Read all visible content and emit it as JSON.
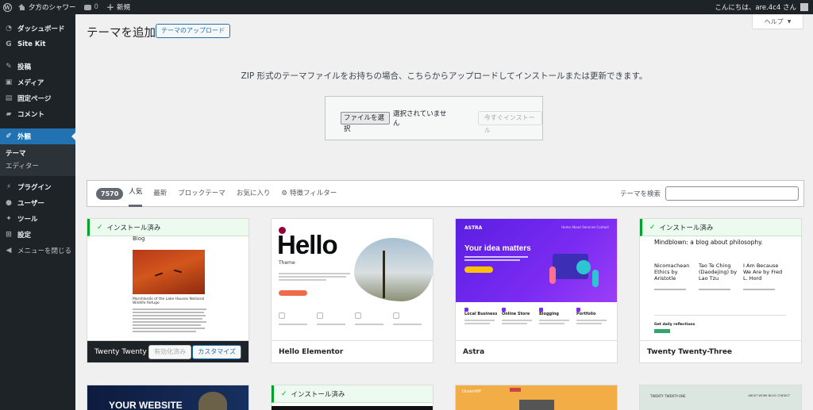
{
  "admin_bar": {
    "site_name": "夕方のシャワー",
    "comments_count": "0",
    "new_label": "新規",
    "greeting": "こんにちは、are.4c4 さん"
  },
  "sidebar": {
    "items": [
      {
        "label": "ダッシュボード",
        "icon": "dashboard-icon"
      },
      {
        "label": "Site Kit",
        "icon": "sitekit-icon"
      },
      {
        "label": "投稿",
        "icon": "pin-icon"
      },
      {
        "label": "メディア",
        "icon": "media-icon"
      },
      {
        "label": "固定ページ",
        "icon": "page-icon"
      },
      {
        "label": "コメント",
        "icon": "comment-icon"
      },
      {
        "label": "外観",
        "icon": "brush-icon"
      },
      {
        "label": "プラグイン",
        "icon": "plugin-icon"
      },
      {
        "label": "ユーザー",
        "icon": "user-icon"
      },
      {
        "label": "ツール",
        "icon": "wrench-icon"
      },
      {
        "label": "設定",
        "icon": "settings-icon"
      },
      {
        "label": "メニューを閉じる",
        "icon": "collapse-icon"
      }
    ],
    "submenu": [
      "テーマ",
      "エディター"
    ]
  },
  "header": {
    "title": "テーマを追加",
    "upload_button": "テーマのアップロード",
    "help": "ヘルプ"
  },
  "upload": {
    "description": "ZIP 形式のテーマファイルをお持ちの場合、こちらからアップロードしてインストールまたは更新できます。",
    "file_button": "ファイルを選択",
    "no_file": "選択されていません",
    "install_button": "今すぐインストール"
  },
  "filter": {
    "count": "7570",
    "tabs": [
      "人気",
      "最新",
      "ブロックテーマ",
      "お気に入り"
    ],
    "feature_filter": "特徴フィルター",
    "search_label": "テーマを検索"
  },
  "installed_label": "インストール済み",
  "themes": [
    {
      "name": "Twenty Twenty",
      "activated": "有効化済み",
      "customize": "カスタマイズ",
      "preview_blog": "Blog",
      "preview_caption": "Marshlands of the Lake Hauses National Wildlife Refuge"
    },
    {
      "name": "Hello Elementor",
      "preview_title": "Hello",
      "preview_sub": "Theme"
    },
    {
      "name": "Astra",
      "preview_logo": "ASTRA",
      "preview_headline": "Your idea matters",
      "preview_nav": "Home   About   Services   Contact",
      "features": [
        "Local Business",
        "Online Store",
        "Blogging",
        "Portfolio"
      ]
    },
    {
      "name": "Twenty Twenty-Three",
      "preview_title": "Mindblown: a blog about philosophy.",
      "posts": [
        {
          "title": "Nicomachean Ethics by Aristotle"
        },
        {
          "title": "Tao Te Ching (Daodejing) by Lao Tzu"
        },
        {
          "title": "I Am Because We Are by Fred L. Hord"
        }
      ],
      "newsletter": "Get daily reflections"
    }
  ],
  "bottom_themes": [
    {
      "preview_text": "YOUR WEBSITE"
    },
    {
      "installed": true
    },
    {
      "preview_logo": "OceanWP"
    },
    {
      "preview_logo": "TWENTY TWENTY-ONE",
      "preview_nav": "ABOUT  WORK  BLOG  CONTACT"
    }
  ]
}
